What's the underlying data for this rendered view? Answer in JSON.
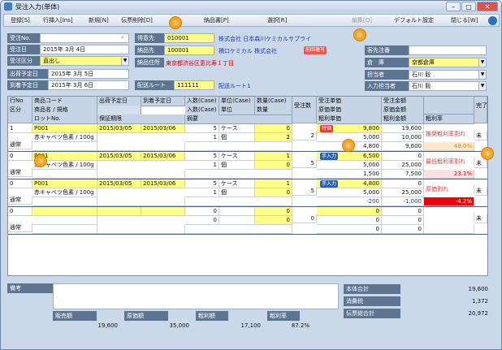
{
  "window": {
    "title": "受注入力(単体)"
  },
  "toolbar": {
    "items": [
      "登録[S]",
      "行挿入[Ins]",
      "新規[N]",
      "伝票削除[D]",
      "納品書[P]",
      "選択[R]",
      "編集[Q]",
      "デフォルト設定",
      "閉じる[W]"
    ]
  },
  "header": {
    "order_no_label": "受注No.",
    "order_no": "",
    "order_date_label": "受注日",
    "order_date": "2015年 3月 4日",
    "order_type_label": "受注区分",
    "order_type": "直出し",
    "ship_date_label": "出荷予定日",
    "ship_date": "2015年 3月 5日",
    "arrive_date_label": "到着予定日",
    "arrive_date": "2015年 3月 6日",
    "bill_to_label": "得意先",
    "bill_to_code": "010001",
    "bill_to_name": "株式会社 日本森川ケミカルサプライ",
    "ship_to_label": "納品先",
    "ship_to_code": "100001",
    "ship_to_name": "積口ケミカル 株式会社",
    "prev_copy": "前回複写",
    "ship_addr_label": "納品住所",
    "ship_addr": "東京都渋谷区恵比寿１丁目",
    "route_label": "配送ルート",
    "route_code": "111111",
    "route_name": "配送ルート1",
    "cust_order_label": "客先注番",
    "cust_order": "",
    "warehouse_label": "倉　庫",
    "warehouse": "京都倉庫",
    "staff_label": "担当者",
    "staff": "石川 毅",
    "entry_staff_label": "入力担当者",
    "entry_staff": "石川 毅"
  },
  "markers": [
    "①",
    "②",
    "③",
    "④",
    "⑤"
  ],
  "grid": {
    "headers": {
      "row_no": "行No",
      "category": "区分",
      "product_code": "商品コード",
      "product_name": "商品名 / 規格",
      "lot_no": "ロットNo.",
      "ship_date": "出荷予定日",
      "expiry": "保証期限",
      "arrive_date": "到着予定日",
      "qty_case": "入数(Case)",
      "unit_case": "単位(Case)",
      "num_case": "数量(Case)",
      "summary": "摘要",
      "unit": "単位",
      "qty": "数量",
      "order_qty": "受注数",
      "order_price": "受注単価",
      "cost_price": "原価単価",
      "gross_price": "粗利単価",
      "order_amount": "受注金額",
      "cost_amount": "原価金額",
      "gross_amount": "粗利金額",
      "gross_rate": "粗利率",
      "done": "完了"
    },
    "rows": [
      {
        "no": "1",
        "kubun": "通常",
        "code": "P001",
        "name": "赤キャベツ色素 / 100g",
        "ship": "2015/03/05",
        "arrive": "2015/03/06",
        "qcase": "5",
        "ucase": "ケース",
        "ncase": "0",
        "qty1": "1",
        "unit": "個",
        "qty": "2",
        "oqty": "2",
        "badge": "特価",
        "oprice": "9,800",
        "cprice": "5,000",
        "gprice": "4,800",
        "oamt": "19,600",
        "camt": "10,000",
        "gamt": "9,600",
        "note": "推奨粗利率割れ",
        "rate": "49.0%",
        "done": "未"
      },
      {
        "no": "0",
        "kubun": "通常",
        "code": "P001",
        "name": "赤キャベツ色素 / 100g",
        "ship": "2015/03/05",
        "arrive": "2015/03/06",
        "qcase": "5",
        "ucase": "ケース",
        "ncase": "1",
        "qty1": "1",
        "unit": "個",
        "qty": "0",
        "oqty": "5",
        "badge": "手入力",
        "oprice": "6,500",
        "cprice": "5,000",
        "gprice": "1,500",
        "oamt": "0",
        "camt": "25,000",
        "gamt": "7,500",
        "note": "最低粗利率割れ",
        "rate": "23.1%",
        "done": "未"
      },
      {
        "no": "0",
        "kubun": "通常",
        "code": "P001",
        "name": "赤キャベツ色素 / 100g",
        "ship": "2015/03/05",
        "arrive": "2015/03/06",
        "qcase": "5",
        "ucase": "ケース",
        "ncase": "1",
        "qty1": "1",
        "unit": "個",
        "qty": "0",
        "oqty": "5",
        "badge": "手入力",
        "oprice": "4,800",
        "cprice": "5,000",
        "gprice": "-200",
        "oamt": "0",
        "camt": "25,000",
        "gamt": "-1,000",
        "note": "原価割れ",
        "rate": "-4.2%",
        "done": "未"
      },
      {
        "no": "0",
        "kubun": "通常",
        "code": "",
        "name": "",
        "ship": "",
        "arrive": "",
        "qcase": "0",
        "ucase": "",
        "ncase": "0",
        "qty1": "0",
        "unit": "",
        "qty": "0",
        "oqty": "0",
        "badge": "",
        "oprice": "0",
        "cprice": "0",
        "gprice": "0",
        "oamt": "0",
        "camt": "0",
        "gamt": "0",
        "note": "",
        "rate": "",
        "done": "未"
      }
    ]
  },
  "footer": {
    "memo_label": "備考",
    "sales_label": "販売額",
    "sales": "19,600",
    "cost_label": "原価額",
    "cost": "35,000",
    "gross_label": "粗利額",
    "gross": "17,100",
    "gross_rate_label": "粗利率",
    "gross_rate": "87.2%",
    "subtotal_label": "本体合計",
    "subtotal": "19,600",
    "tax_label": "消費税",
    "tax": "1,372",
    "total_label": "伝票総合計",
    "total": "20,972"
  }
}
